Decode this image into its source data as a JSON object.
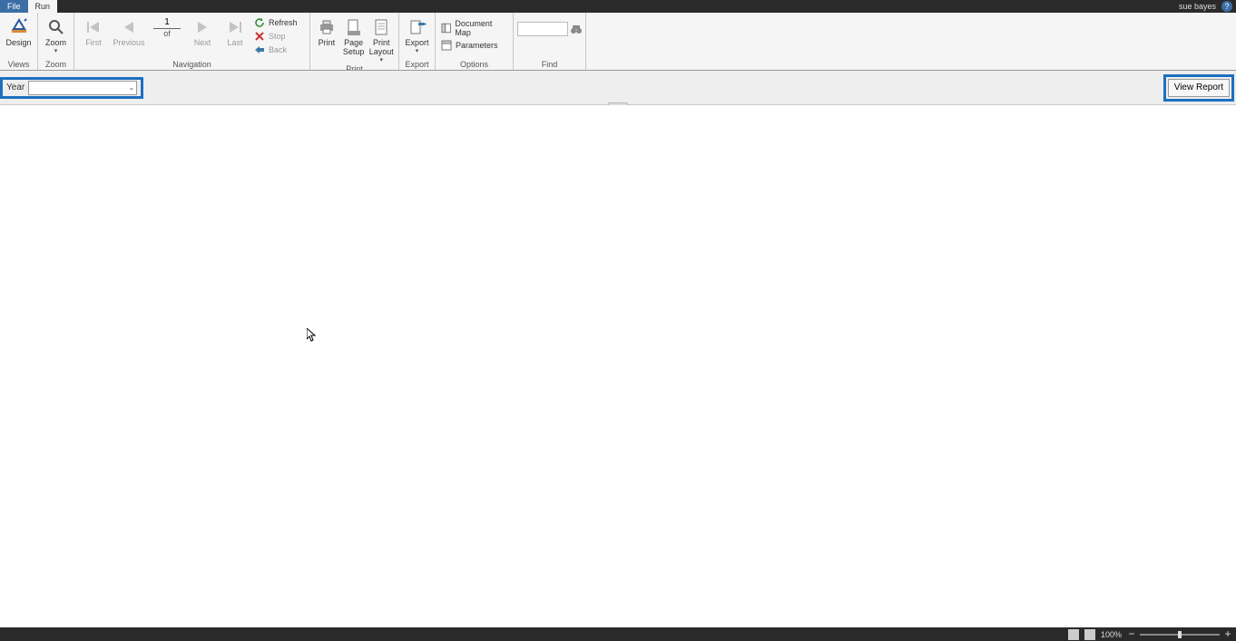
{
  "titlebar": {
    "tabs": {
      "file": "File",
      "run": "Run"
    },
    "user": "sue bayes",
    "help": "?"
  },
  "ribbon": {
    "views": {
      "label": "Views",
      "design": "Design"
    },
    "zoom": {
      "label": "Zoom",
      "zoom": "Zoom"
    },
    "navigation": {
      "label": "Navigation",
      "first": "First",
      "previous": "Previous",
      "next": "Next",
      "last": "Last",
      "page_value": "1",
      "page_of": "of",
      "refresh": "Refresh",
      "stop": "Stop",
      "back": "Back"
    },
    "print": {
      "label": "Print",
      "print": "Print",
      "page_setup": "Page\nSetup",
      "print_layout": "Print\nLayout"
    },
    "export": {
      "label": "Export",
      "export": "Export"
    },
    "options": {
      "label": "Options",
      "doc_map": "Document Map",
      "parameters": "Parameters"
    },
    "find": {
      "label": "Find",
      "value": ""
    }
  },
  "parambar": {
    "year_label": "Year",
    "year_value": "",
    "view_report": "View Report"
  },
  "statusbar": {
    "zoom_pct": "100%"
  }
}
